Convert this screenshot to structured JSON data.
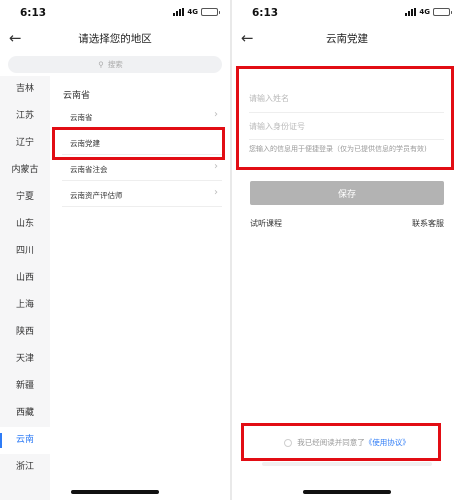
{
  "left_screen": {
    "status": {
      "time": "6:13",
      "network": "4G"
    },
    "nav": {
      "title": "请选择您的地区"
    },
    "search": {
      "placeholder": "搜索"
    },
    "provinces": [
      {
        "label": "吉林"
      },
      {
        "label": "江苏"
      },
      {
        "label": "辽宁"
      },
      {
        "label": "内蒙古"
      },
      {
        "label": "宁夏"
      },
      {
        "label": "山东"
      },
      {
        "label": "四川"
      },
      {
        "label": "山西"
      },
      {
        "label": "上海"
      },
      {
        "label": "陕西"
      },
      {
        "label": "天津"
      },
      {
        "label": "新疆"
      },
      {
        "label": "西藏"
      },
      {
        "label": "云南",
        "selected": true
      },
      {
        "label": "浙江"
      }
    ],
    "sub": {
      "heading": "云南省",
      "items": [
        {
          "label": "云南省"
        },
        {
          "label": "云南党建"
        },
        {
          "label": "云南省注会"
        },
        {
          "label": "云南资产评估师"
        }
      ]
    }
  },
  "right_screen": {
    "status": {
      "time": "6:13",
      "network": "4G"
    },
    "nav": {
      "title": "云南党建"
    },
    "form": {
      "name_placeholder": "请输入姓名",
      "id_placeholder": "请输入身份证号",
      "hint": "您输入的信息用于便捷登录（仅为已提供信息的学员有效)",
      "save_label": "保存"
    },
    "links": {
      "trial": "试听课程",
      "support": "联系客服"
    },
    "agreement": {
      "text": "我已经阅读并同意了",
      "link": "《使用协议》"
    }
  },
  "colors": {
    "accent": "#2f7cf6",
    "highlight_box": "#e20d14",
    "save_disabled": "#b3b3b3"
  }
}
